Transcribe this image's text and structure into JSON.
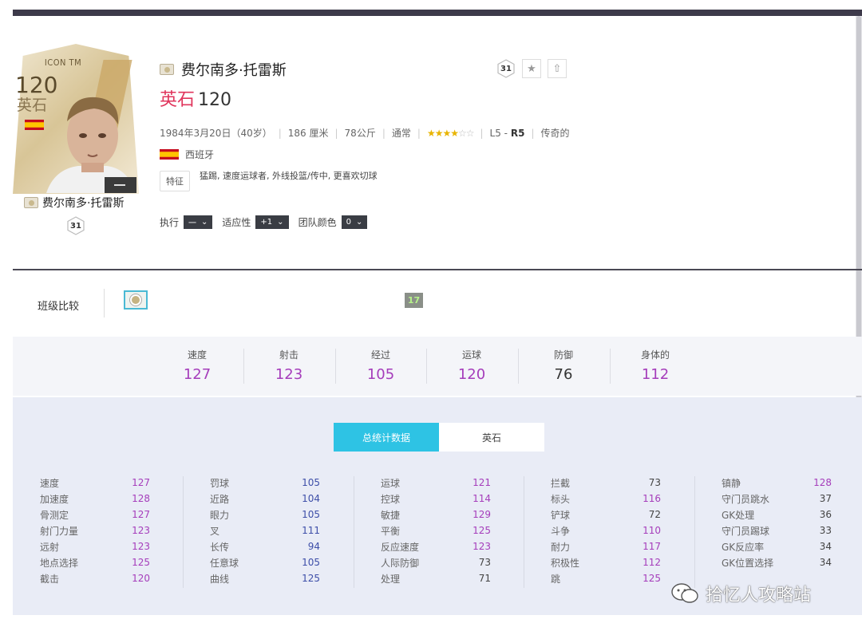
{
  "card": {
    "label": "ICON TM",
    "ovr": "120",
    "position": "英石",
    "name": "费尔南多·托雷斯",
    "level": "31"
  },
  "player": {
    "name": "费尔南多·托雷斯",
    "position": "英石",
    "ovr": "120",
    "birth": "1984年3月20日（40岁）",
    "height": "186 厘米",
    "weight": "78公斤",
    "body": "通常",
    "skill_stars": 4,
    "skill_stars_max": 6,
    "level_prefix": "L5 -",
    "level_bold": "R5",
    "rarity": "传奇的",
    "nation": "西班牙",
    "trait_label": "特征",
    "traits": "猛踢, 速度运球者, 外线投篮/传中, 更喜欢切球",
    "badge_level": "31"
  },
  "controls": {
    "exec_label": "执行",
    "exec_value": "一",
    "adapt_label": "适应性",
    "adapt_value": "+1",
    "team_color_label": "团队颜色",
    "team_color_value": "0"
  },
  "compare": {
    "label": "班级比较",
    "number": "17"
  },
  "summary": [
    {
      "label": "速度",
      "value": "127"
    },
    {
      "label": "射击",
      "value": "123"
    },
    {
      "label": "经过",
      "value": "105"
    },
    {
      "label": "运球",
      "value": "120"
    },
    {
      "label": "防御",
      "value": "76"
    },
    {
      "label": "身体的",
      "value": "112"
    }
  ],
  "tabs": [
    "总统计数据",
    "英石"
  ],
  "stats": [
    [
      {
        "n": "速度",
        "v": "127"
      },
      {
        "n": "加速度",
        "v": "128"
      },
      {
        "n": "骨测定",
        "v": "127"
      },
      {
        "n": "射门力量",
        "v": "123"
      },
      {
        "n": "远射",
        "v": "123"
      },
      {
        "n": "地点选择",
        "v": "125"
      },
      {
        "n": "截击",
        "v": "120"
      }
    ],
    [
      {
        "n": "罚球",
        "v": "105"
      },
      {
        "n": "近路",
        "v": "104"
      },
      {
        "n": "眼力",
        "v": "105"
      },
      {
        "n": "叉",
        "v": "111"
      },
      {
        "n": "长传",
        "v": "94"
      },
      {
        "n": "任意球",
        "v": "105"
      },
      {
        "n": "曲线",
        "v": "125"
      }
    ],
    [
      {
        "n": "运球",
        "v": "121"
      },
      {
        "n": "控球",
        "v": "114"
      },
      {
        "n": "敏捷",
        "v": "129"
      },
      {
        "n": "平衡",
        "v": "125"
      },
      {
        "n": "反应速度",
        "v": "123"
      },
      {
        "n": "人际防御",
        "v": "73"
      },
      {
        "n": "处理",
        "v": "71"
      }
    ],
    [
      {
        "n": "拦截",
        "v": "73"
      },
      {
        "n": "标头",
        "v": "116"
      },
      {
        "n": "铲球",
        "v": "72"
      },
      {
        "n": "斗争",
        "v": "110"
      },
      {
        "n": "耐力",
        "v": "117"
      },
      {
        "n": "积极性",
        "v": "112"
      },
      {
        "n": "跳",
        "v": "125"
      }
    ],
    [
      {
        "n": "镇静",
        "v": "128"
      },
      {
        "n": "守门员跳水",
        "v": "37"
      },
      {
        "n": "GK处理",
        "v": "36"
      },
      {
        "n": "守门员踢球",
        "v": "33"
      },
      {
        "n": "GK反应率",
        "v": "34"
      },
      {
        "n": "GK位置选择",
        "v": "34"
      }
    ]
  ],
  "watermark": "拾忆人攻略站"
}
